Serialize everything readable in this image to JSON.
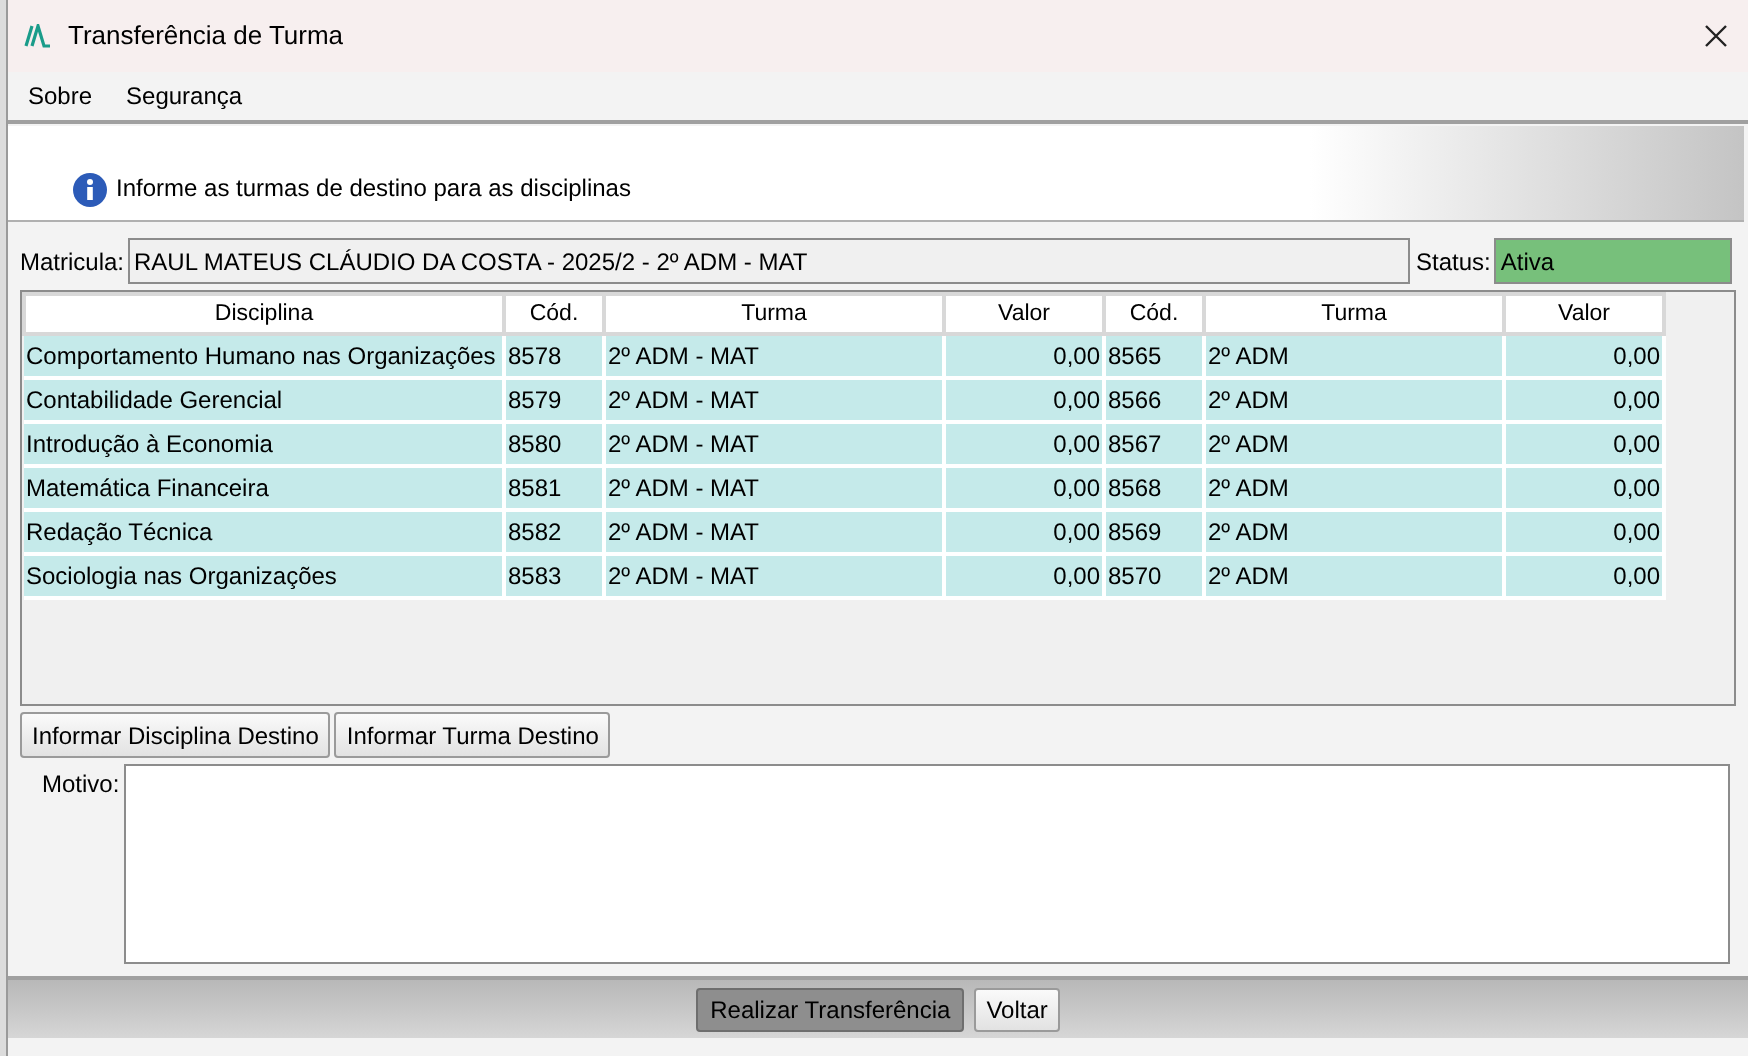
{
  "window": {
    "title": "Transferência de Turma"
  },
  "menu": [
    "Sobre",
    "Segurança"
  ],
  "info": {
    "message": "Informe as turmas de destino para as disciplinas"
  },
  "matricula": {
    "label": "Matricula:",
    "value": "RAUL MATEUS CLÁUDIO DA COSTA - 2025/2 - 2º ADM - MAT"
  },
  "status": {
    "label": "Status:",
    "value": "Ativa",
    "color": "#77c07b"
  },
  "table": {
    "columns": [
      "Disciplina",
      "Cód.",
      "Turma",
      "Valor",
      "Cód.",
      "Turma",
      "Valor"
    ],
    "rows": [
      [
        "Comportamento Humano nas Organizações",
        "8578",
        "2º ADM - MAT",
        "0,00",
        "8565",
        "2º ADM",
        "0,00"
      ],
      [
        "Contabilidade Gerencial",
        "8579",
        "2º ADM - MAT",
        "0,00",
        "8566",
        "2º ADM",
        "0,00"
      ],
      [
        "Introdução à Economia",
        "8580",
        "2º ADM - MAT",
        "0,00",
        "8567",
        "2º ADM",
        "0,00"
      ],
      [
        "Matemática Financeira",
        "8581",
        "2º ADM - MAT",
        "0,00",
        "8568",
        "2º ADM",
        "0,00"
      ],
      [
        "Redação Técnica",
        "8582",
        "2º ADM - MAT",
        "0,00",
        "8569",
        "2º ADM",
        "0,00"
      ],
      [
        "Sociologia nas Organizações",
        "8583",
        "2º ADM - MAT",
        "0,00",
        "8570",
        "2º ADM",
        "0,00"
      ]
    ]
  },
  "actions": [
    "Informar Disciplina Destino",
    "Informar Turma Destino"
  ],
  "motivo": {
    "label": "Motivo:"
  },
  "footer_buttons": [
    {
      "label": "Realizar Transferência",
      "focused": true
    },
    {
      "label": "Voltar",
      "focused": false
    }
  ]
}
